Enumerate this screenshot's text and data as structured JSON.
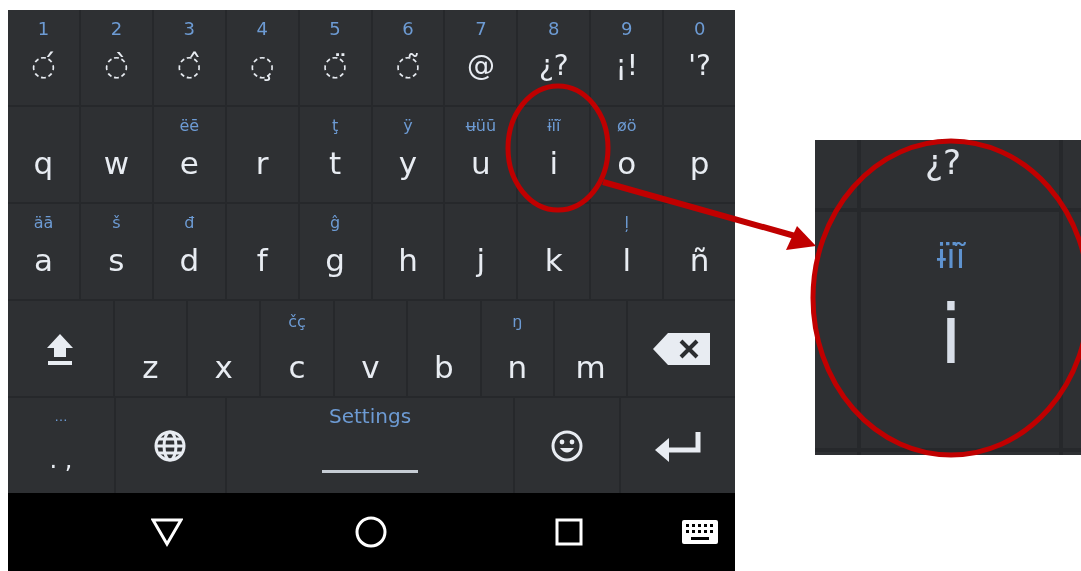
{
  "keyboard": {
    "rows": [
      [
        {
          "kind": "char",
          "hint": "1",
          "label": "◌́"
        },
        {
          "kind": "char",
          "hint": "2",
          "label": "◌̀"
        },
        {
          "kind": "char",
          "hint": "3",
          "label": "◌̂"
        },
        {
          "kind": "char",
          "hint": "4",
          "label": "◌̧"
        },
        {
          "kind": "char",
          "hint": "5",
          "label": "◌̈"
        },
        {
          "kind": "char",
          "hint": "6",
          "label": "◌̃"
        },
        {
          "kind": "char",
          "hint": "7",
          "label": "@"
        },
        {
          "kind": "char",
          "hint": "8",
          "label": "¿?"
        },
        {
          "kind": "char",
          "hint": "9",
          "label": "¡!"
        },
        {
          "kind": "char",
          "hint": "0",
          "label": "'?"
        }
      ],
      [
        {
          "kind": "char",
          "label": "q"
        },
        {
          "kind": "char",
          "label": "w"
        },
        {
          "kind": "char",
          "hint": "ëē",
          "label": "e"
        },
        {
          "kind": "char",
          "label": "r"
        },
        {
          "kind": "char",
          "hint": "ţ",
          "label": "t"
        },
        {
          "kind": "char",
          "hint": "ÿ",
          "label": "y"
        },
        {
          "kind": "char",
          "hint": "ʉüū",
          "label": "u"
        },
        {
          "kind": "char",
          "hint": "ɨïĩ",
          "label": "i"
        },
        {
          "kind": "char",
          "hint": "øö",
          "label": "o"
        },
        {
          "kind": "char",
          "label": "p"
        }
      ],
      [
        {
          "kind": "char",
          "hint": "äā",
          "label": "a"
        },
        {
          "kind": "char",
          "hint": "š",
          "label": "s"
        },
        {
          "kind": "char",
          "hint": "đ",
          "label": "d"
        },
        {
          "kind": "char",
          "label": "f"
        },
        {
          "kind": "char",
          "hint": "ĝ",
          "label": "g"
        },
        {
          "kind": "char",
          "label": "h"
        },
        {
          "kind": "char",
          "label": "j"
        },
        {
          "kind": "char",
          "label": "k"
        },
        {
          "kind": "char",
          "hint": "ļ",
          "label": "l"
        },
        {
          "kind": "char",
          "label": "ñ"
        }
      ],
      [
        {
          "kind": "shift"
        },
        {
          "kind": "char",
          "label": "z"
        },
        {
          "kind": "char",
          "label": "x"
        },
        {
          "kind": "char",
          "hint": "čç",
          "label": "c"
        },
        {
          "kind": "char",
          "label": "v"
        },
        {
          "kind": "char",
          "label": "b"
        },
        {
          "kind": "char",
          "hint": "ŋ",
          "label": "n"
        },
        {
          "kind": "char",
          "label": "m"
        },
        {
          "kind": "backspace"
        }
      ]
    ],
    "function_row": [
      {
        "kind": "punct",
        "hint": "…",
        "label": ". ,"
      },
      {
        "kind": "globe"
      },
      {
        "kind": "space",
        "label": "Settings"
      },
      {
        "kind": "emoji"
      },
      {
        "kind": "enter"
      }
    ]
  },
  "nav_bar": [
    {
      "kind": "back"
    },
    {
      "kind": "home"
    },
    {
      "kind": "recents"
    },
    {
      "kind": "keyboard"
    }
  ],
  "callout": {
    "above": "¿?",
    "hint": "ɨïĩ",
    "label": "i"
  }
}
